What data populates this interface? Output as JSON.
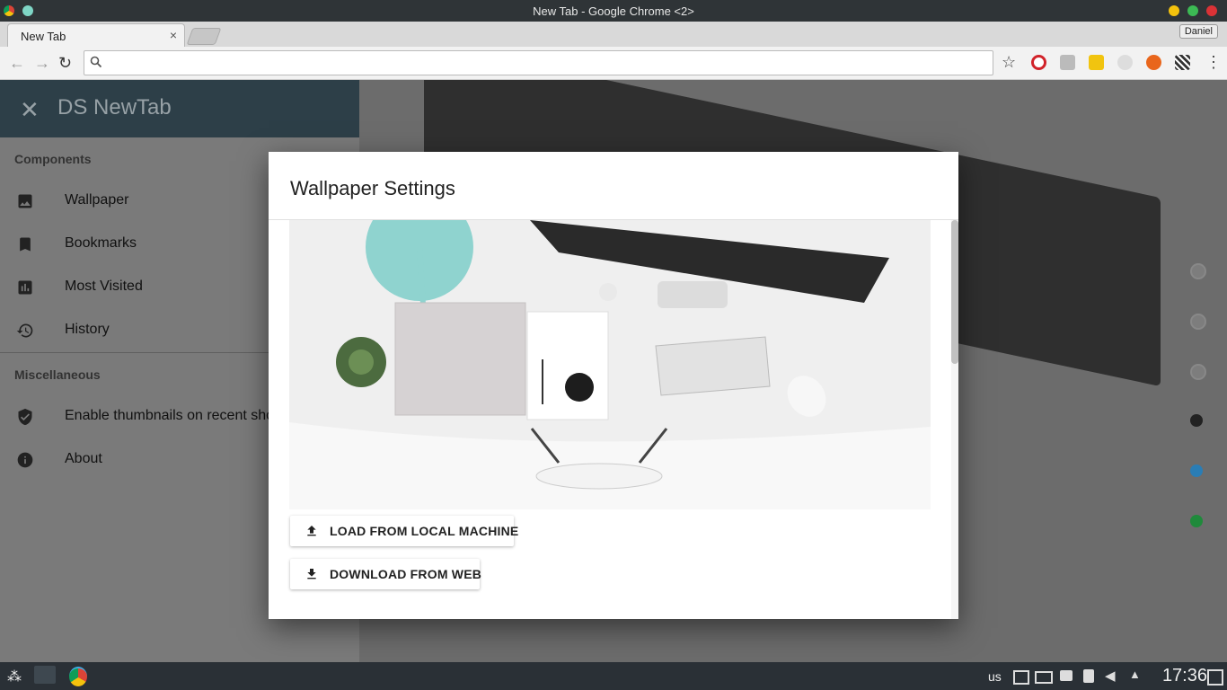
{
  "window": {
    "title": "New Tab - Google Chrome <2>",
    "controls": {
      "minimize_color": "#f4c20d",
      "maximize_color": "#3cba54",
      "close_color": "#db3236"
    }
  },
  "tabs": [
    {
      "label": "New Tab",
      "close": "×"
    }
  ],
  "profile_button": "Daniel",
  "toolbar": {
    "omnibox_value": "",
    "omnibox_placeholder": ""
  },
  "extensions": [
    "bookmark-star-icon",
    "opera-icon",
    "react-icon",
    "notes-icon",
    "ghost-icon",
    "ubuntu-icon",
    "qr-icon",
    "chrome-menu-icon"
  ],
  "drawer": {
    "title": "DS NewTab",
    "close_label": "✕",
    "sections": [
      {
        "title": "Components",
        "items": [
          {
            "label": "Wallpaper",
            "icon": "image-icon"
          },
          {
            "label": "Bookmarks",
            "icon": "bookmark-icon"
          },
          {
            "label": "Most Visited",
            "icon": "bar-chart-icon"
          },
          {
            "label": "History",
            "icon": "history-icon"
          }
        ]
      },
      {
        "title": "Miscellaneous",
        "items": [
          {
            "label": "Enable thumbnails on recent sho",
            "icon": "shield-check-icon"
          },
          {
            "label": "About",
            "icon": "info-icon"
          }
        ]
      }
    ]
  },
  "dialog": {
    "title": "Wallpaper Settings",
    "buttons": [
      {
        "label": "LOAD FROM LOCAL MACHINE",
        "icon": "upload-icon"
      },
      {
        "label": "DOWNLOAD FROM WEB",
        "icon": "download-icon"
      }
    ]
  },
  "taskbar": {
    "keyboard_layout": "us",
    "clock": "17:36"
  }
}
